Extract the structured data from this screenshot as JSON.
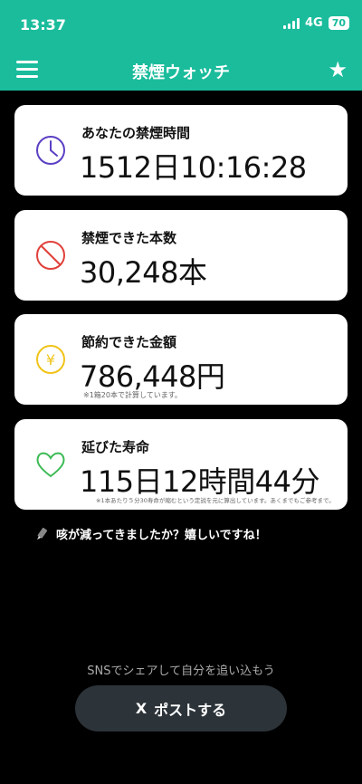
{
  "status": {
    "time": "13:37",
    "network": "4G",
    "battery": "70"
  },
  "header": {
    "title": "禁煙ウォッチ",
    "menu_icon": "hamburger-menu-icon",
    "favorite_icon": "star-icon"
  },
  "cards": [
    {
      "label": "あなたの禁煙時間",
      "value": "1512日10:16:28",
      "icon": "clock-icon",
      "color": "#5b3fc4"
    },
    {
      "label": "禁煙できた本数",
      "value": "30,248本",
      "icon": "no-sign-icon",
      "color": "#e0403a"
    },
    {
      "label": "節約できた金額",
      "value": "786,448円",
      "note": "※1箱20本で計算しています。",
      "icon": "yen-icon",
      "color": "#f0c419"
    },
    {
      "label": "延びた寿命",
      "value": "115日12時間44分",
      "note": "※1本あたり５分30寿命が縮むという定説を元に算出しています。あくまでもご参考まで。",
      "icon": "heart-icon",
      "color": "#3cba54"
    }
  ],
  "message": {
    "icon": "pencil-icon",
    "text": "咳が減ってきましたか？嬉しいですね！"
  },
  "share": {
    "caption": "SNSでシェアして自分を追い込もう",
    "button_label": "ポストする",
    "button_icon": "X"
  }
}
